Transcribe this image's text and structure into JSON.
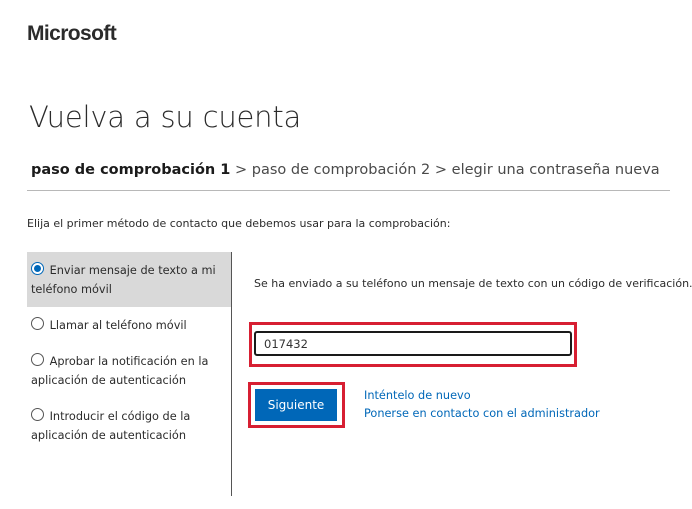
{
  "brand": {
    "logo_text": "Microsoft"
  },
  "page": {
    "title": "Vuelva a su cuenta"
  },
  "breadcrumb": {
    "current": "paso de comprobación 1",
    "separator": ">",
    "step2": "paso de comprobación 2",
    "step3": "elegir una contraseña nueva"
  },
  "instruction": "Elija el primer método de contacto que debemos usar para la comprobación:",
  "options": [
    {
      "line1": "Enviar mensaje de texto a mi",
      "line2": "teléfono móvil",
      "selected": true
    },
    {
      "line1": "Llamar al teléfono móvil",
      "line2": "",
      "selected": false
    },
    {
      "line1": "Aprobar la notificación en la",
      "line2": "aplicación de autenticación",
      "selected": false
    },
    {
      "line1": "Introducir el código de la",
      "line2": "aplicación de autenticación",
      "selected": false
    }
  ],
  "verification": {
    "message": "Se ha enviado a su teléfono un mensaje de texto con un código de verificación.",
    "code_value": "017432"
  },
  "actions": {
    "next_label": "Siguiente",
    "retry_link": "Inténtelo de nuevo",
    "contact_admin_link": "Ponerse en contacto con el administrador"
  },
  "colors": {
    "accent": "#0067b8",
    "highlight": "#d71f32",
    "selected_bg": "#d9d9d9"
  }
}
